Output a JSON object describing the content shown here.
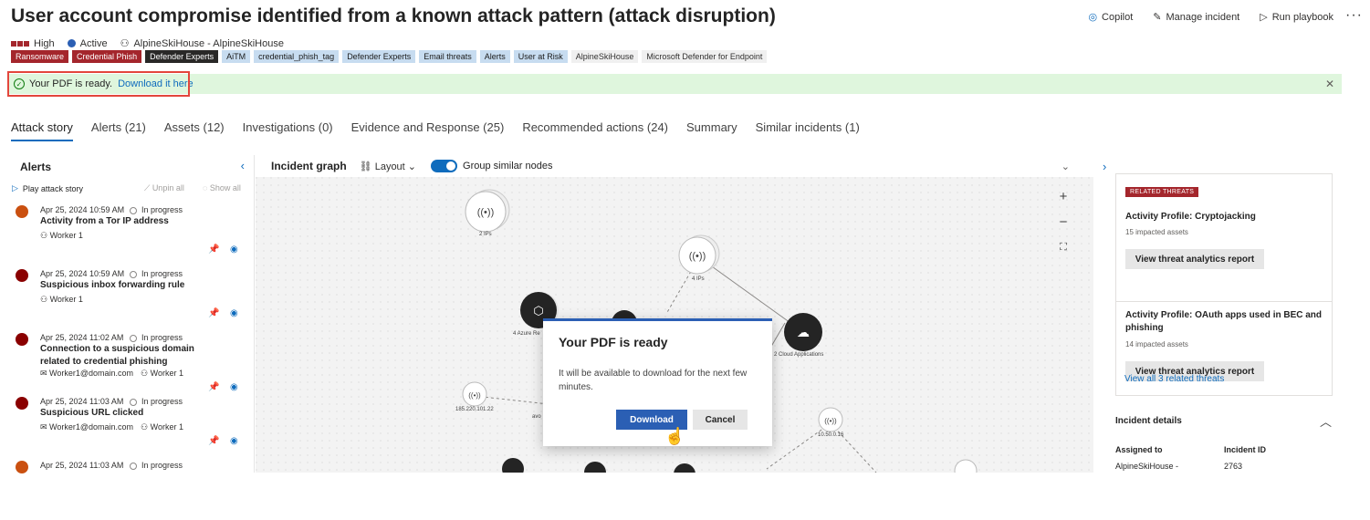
{
  "incident": {
    "title": "User account compromise identified from a known attack pattern (attack disruption)",
    "severity": "High",
    "status": "Active",
    "owner": "AlpineSkiHouse - AlpineSkiHouse"
  },
  "header_actions": {
    "copilot": "Copilot",
    "manage": "Manage incident",
    "playbook": "Run playbook",
    "more": "···"
  },
  "tags": [
    {
      "label": "Ransomware",
      "style": "red"
    },
    {
      "label": "Credential Phish",
      "style": "red"
    },
    {
      "label": "Defender Experts",
      "style": "dark"
    },
    {
      "label": "AiTM",
      "style": "blue"
    },
    {
      "label": "credential_phish_tag",
      "style": "blue"
    },
    {
      "label": "Defender Experts",
      "style": "blue"
    },
    {
      "label": "Email threats",
      "style": "blue"
    },
    {
      "label": "Alerts",
      "style": "blue"
    },
    {
      "label": "User at Risk",
      "style": "blue"
    },
    {
      "label": "AlpineSkiHouse",
      "style": "grey"
    },
    {
      "label": "Microsoft Defender for Endpoint",
      "style": "grey"
    }
  ],
  "banner": {
    "message": "Your PDF is ready.",
    "link": "Download it here"
  },
  "tabs": [
    "Attack story",
    "Alerts (21)",
    "Assets (12)",
    "Investigations (0)",
    "Evidence and Response (25)",
    "Recommended actions (24)",
    "Summary",
    "Similar incidents (1)"
  ],
  "alerts_panel": {
    "title": "Alerts",
    "play": "Play attack story",
    "unpin": "Unpin all",
    "show": "Show all",
    "items": [
      {
        "date": "Apr 25, 2024 10:59 AM",
        "status": "In progress",
        "title": "Activity from a Tor IP address",
        "entities": [
          "Worker 1"
        ],
        "color": "#ca5010"
      },
      {
        "date": "Apr 25, 2024 10:59 AM",
        "status": "In progress",
        "title": "Suspicious inbox forwarding rule",
        "entities": [
          "Worker 1"
        ],
        "color": "#8a0000"
      },
      {
        "date": "Apr 25, 2024 11:02 AM",
        "status": "In progress",
        "title": "Connection to a suspicious domain related to credential phishing",
        "entities": [
          "Worker1@domain.com",
          "Worker 1"
        ],
        "color": "#8a0000"
      },
      {
        "date": "Apr 25, 2024 11:03 AM",
        "status": "In progress",
        "title": "Suspicious URL clicked",
        "entities": [
          "Worker1@domain.com",
          "Worker 1"
        ],
        "color": "#8a0000"
      },
      {
        "date": "Apr 25, 2024 11:03 AM",
        "status": "In progress",
        "title": "",
        "entities": [],
        "color": "#ca5010"
      }
    ]
  },
  "graph": {
    "title": "Incident graph",
    "layout": "Layout",
    "group": "Group similar nodes",
    "labels": {
      "ips2": "2 IPs",
      "ips4": "4 IPs",
      "azure": "4 Azure Re",
      "cloud": "2 Cloud Applications",
      "ip1": "185.220.101.22",
      "ip2": "10.50.0.16",
      "avo": "avo"
    }
  },
  "related_threats": {
    "badge": "RELATED THREATS",
    "threats": [
      {
        "name": "Activity Profile: Cryptojacking",
        "impact": "15 impacted assets",
        "button": "View threat analytics report"
      },
      {
        "name": "Activity Profile: OAuth apps used in BEC and phishing",
        "impact": "14 impacted assets",
        "button": "View threat analytics report"
      }
    ],
    "view_all": "View all 3 related threats"
  },
  "incident_details": {
    "title": "Incident details",
    "assigned_label": "Assigned to",
    "assigned_value": "AlpineSkiHouse -",
    "id_label": "Incident ID",
    "id_value": "2763"
  },
  "dialog": {
    "title": "Your PDF is ready",
    "body": "It will be available to download for the next few minutes.",
    "download": "Download",
    "cancel": "Cancel"
  }
}
